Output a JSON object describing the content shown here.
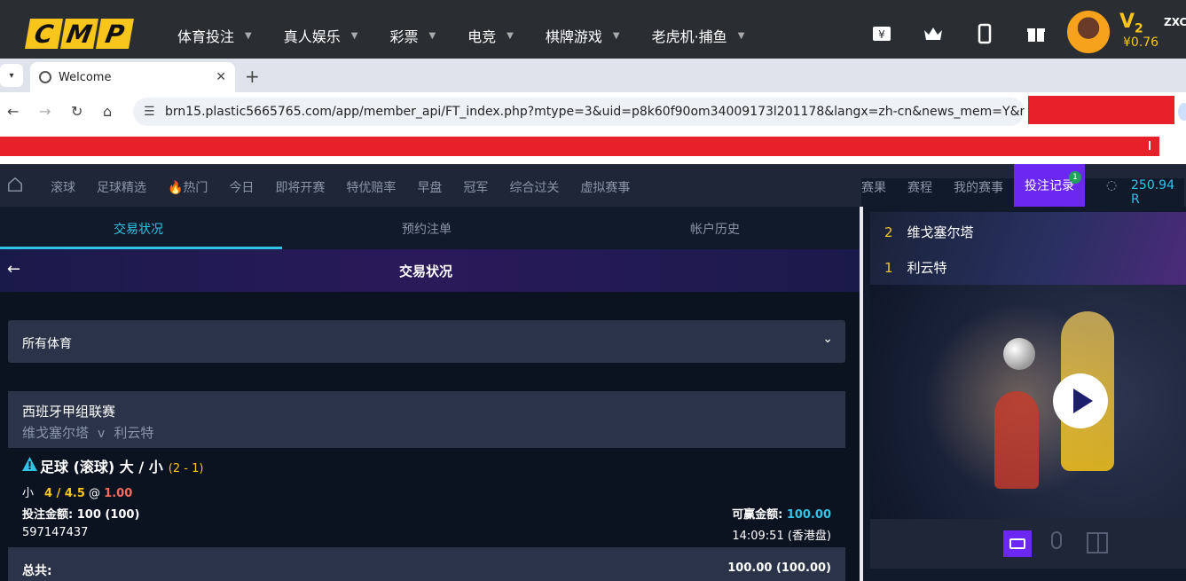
{
  "site_header": {
    "logo_letters": [
      "C",
      "M",
      "P"
    ],
    "nav": [
      {
        "label": "体育投注"
      },
      {
        "label": "真人娱乐"
      },
      {
        "label": "彩票"
      },
      {
        "label": "电竞"
      },
      {
        "label": "棋牌游戏"
      },
      {
        "label": "老虎机·捕鱼"
      }
    ],
    "icons": [
      "deposit-icon",
      "crown-icon",
      "mobile-icon",
      "gift-icon"
    ],
    "vip_label": "V",
    "vip_level": "2",
    "balance": "¥0.76",
    "username": "ZXC"
  },
  "browser": {
    "tab_title": "Welcome",
    "new_tab": "+",
    "url": "brn15.plastic5665765.com/app/member_api/FT_index.php?mtype=3&uid=p8k60f90om34009173l201178&langx=zh-cn&news_mem=Y&new..."
  },
  "sitenav": {
    "links": [
      "滚球",
      "足球精选",
      "🔥热门",
      "今日",
      "即将开赛",
      "特优赔率",
      "早盘",
      "冠军",
      "综合过关",
      "虚拟赛事"
    ],
    "right_links": [
      "赛果",
      "赛程",
      "我的赛事"
    ],
    "bet_record": "投注记录",
    "bet_record_count": "1",
    "credit": "250.94",
    "credit_suffix": "R"
  },
  "subtabs": {
    "items": [
      "交易状况",
      "预约注单",
      "帐户历史"
    ]
  },
  "banner": {
    "title": "交易状况"
  },
  "filter": {
    "label": "所有体育"
  },
  "bet": {
    "league": "西班牙甲组联赛",
    "home": "维戈塞尔塔",
    "vs": "v",
    "away": "利云特",
    "market": "足球 (滚球) 大 / 小",
    "score": "(2 - 1)",
    "selection": "小",
    "handicap": "4 / 4.5",
    "at": "@",
    "odds": "1.00",
    "stake_label": "投注金额:",
    "stake_value": "100 (100)",
    "win_label": "可赢金额:",
    "win_value": "100.00",
    "ticket_id": "597147437",
    "time": "14:09:51 (香港盘)"
  },
  "total": {
    "label": "总共:",
    "value": "100.00 (100.00)"
  },
  "right_panel": {
    "leaderboard": [
      {
        "rank": "2",
        "team": "维戈塞尔塔"
      },
      {
        "rank": "1",
        "team": "利云特"
      }
    ]
  }
}
